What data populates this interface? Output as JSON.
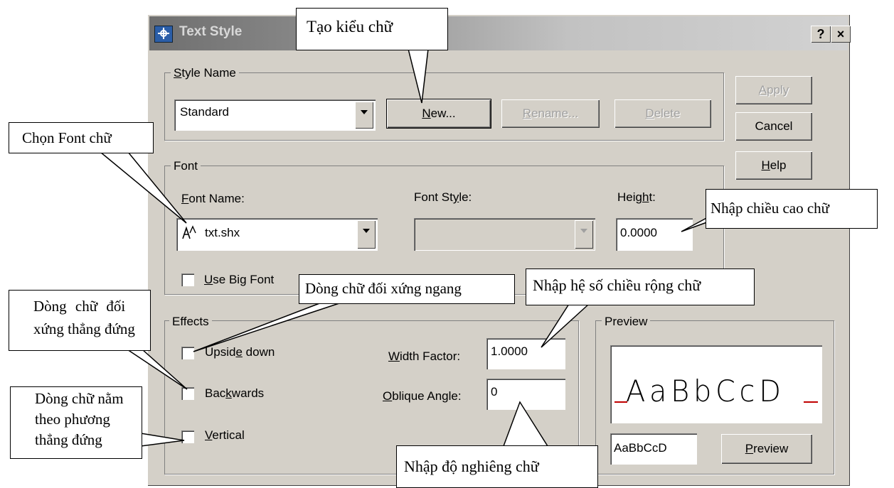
{
  "window": {
    "title": "Text Style",
    "help_btn": "?",
    "close_btn": "×"
  },
  "style_name": {
    "group_label": "Style Name",
    "selected": "Standard",
    "new_label": "New...",
    "rename_label": "Rename...",
    "delete_label": "Delete"
  },
  "side_buttons": {
    "apply": "Apply",
    "cancel": "Cancel",
    "help": "Help"
  },
  "font": {
    "group_label": "Font",
    "font_name_label": "Font Name:",
    "font_name_value": "txt.shx",
    "font_style_label": "Font Style:",
    "font_style_value": "",
    "height_label": "Height:",
    "height_value": "0.0000",
    "use_big_font": "Use Big Font"
  },
  "effects": {
    "group_label": "Effects",
    "upside_down": "Upside down",
    "backwards": "Backwards",
    "vertical": "Vertical",
    "width_factor_label": "Width Factor:",
    "width_factor_value": "1.0000",
    "oblique_angle_label": "Oblique Angle:",
    "oblique_angle_value": "0"
  },
  "preview": {
    "group_label": "Preview",
    "sample_display": "AaBbCcD",
    "sample_input": "AaBbCcD",
    "preview_button": "Preview"
  },
  "callouts": {
    "create_style": "Tạo kiểu chữ",
    "choose_font": "Chọn Font chữ",
    "enter_height": "Nhập chiều cao chữ",
    "horizontal_mirror": "Dòng chữ đối xứng ngang",
    "width_factor": "Nhập hệ số chiều rộng chữ",
    "vertical_mirror_line1": "Dòng  chữ  đối",
    "vertical_mirror_line2": "xứng thẳng đứng",
    "vertical_line1": "Dòng chữ nằm",
    "vertical_line2": "theo phương",
    "vertical_line3": "thẳng đứng",
    "oblique": "Nhập độ nghiêng chữ"
  }
}
